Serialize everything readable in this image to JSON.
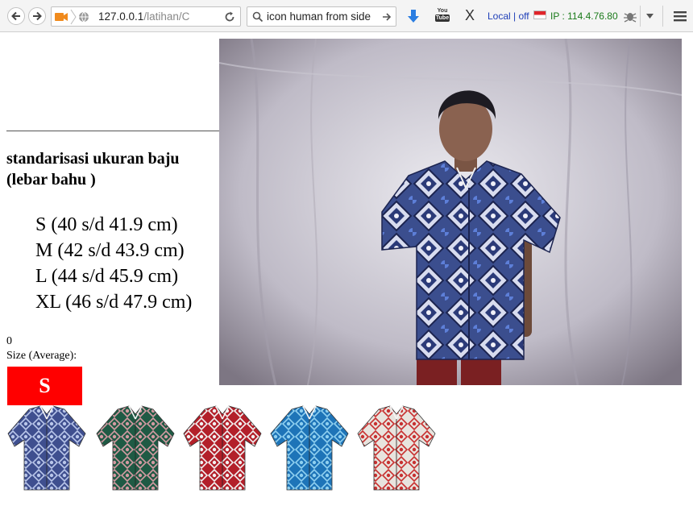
{
  "browser": {
    "url": "127.0.0.1/latihan/C",
    "url_host": "127.0.0.1",
    "url_path": "/latihan/C",
    "search_query": "icon human from side",
    "youtube_label": "You Tube",
    "local_status": "Local | off",
    "ip_label": "IP : 114.4.76.80",
    "close_label": "X"
  },
  "page": {
    "heading_line1": "standarisasi ukuran baju",
    "heading_line2": "(lebar bahu )",
    "sizes": [
      "S (40 s/d 41.9 cm)",
      "M (42 s/d 43.9 cm)",
      "L (44 s/d 45.9 cm)",
      "XL (46 s/d 47.9 cm)"
    ],
    "counter": "0",
    "average_label": "Size (Average):",
    "average_size": "S",
    "average_color": "#ff0000"
  },
  "shirts": [
    {
      "name": "batik-shirt-blue-patchwork",
      "base": "#3f4f8f",
      "accent": "#b9c6ea"
    },
    {
      "name": "batik-shirt-green",
      "base": "#1f5a44",
      "accent": "#d39aa2"
    },
    {
      "name": "batik-shirt-red",
      "base": "#b3202a",
      "accent": "#f2f2f2"
    },
    {
      "name": "batik-shirt-cyan",
      "base": "#1e74b8",
      "accent": "#8fd0f0"
    },
    {
      "name": "batik-shirt-white-floral",
      "base": "#e8e4de",
      "accent": "#c83030"
    }
  ]
}
